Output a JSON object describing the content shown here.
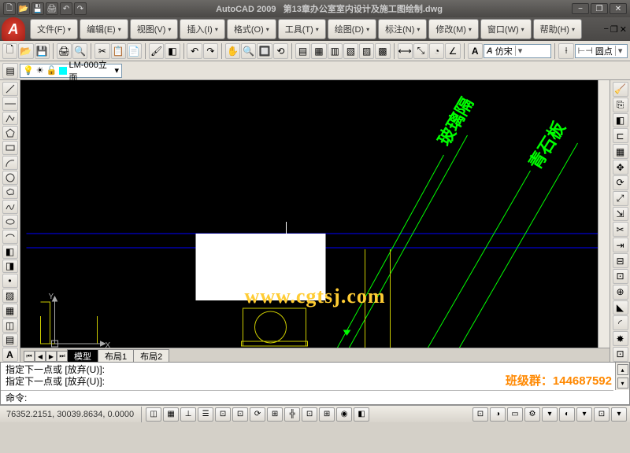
{
  "title": {
    "app": "AutoCAD 2009",
    "doc": "第13章办公室室内设计及施工图绘制.dwg"
  },
  "qat": {
    "save": "💾",
    "new": "🗋",
    "open": "📂",
    "undo": "↶",
    "redo": "↷",
    "plot": "🖨"
  },
  "win": {
    "min": "−",
    "max": "❐",
    "close": "✕"
  },
  "menu": {
    "file": "文件(F)",
    "edit": "编辑(E)",
    "view": "视图(V)",
    "insert": "插入(I)",
    "format": "格式(O)",
    "tools": "工具(T)",
    "draw": "绘图(D)",
    "dimension": "标注(N)",
    "modify": "修改(M)",
    "window": "窗口(W)",
    "help": "帮助(H)"
  },
  "layer": {
    "current": "LM-000立面"
  },
  "style": {
    "font": "仿宋",
    "dim": "圆点"
  },
  "tabs": {
    "model": "模型",
    "layout1": "布局1",
    "layout2": "布局2"
  },
  "cmd": {
    "line1": "指定下一点或 [放弃(U)]:",
    "line2": "指定下一点或 [放弃(U)]:",
    "prompt": "命令:"
  },
  "overlay": {
    "group": "班级群：144687592"
  },
  "status": {
    "coords": "76352.2151, 30039.8634, 0.0000"
  },
  "watermark": "www.cgtsj.com",
  "canvas": {
    "ann1": "玻璃隔",
    "ann2": "青石板",
    "ucs_x": "X",
    "ucs_y": "Y"
  },
  "statusbtns": [
    "◫",
    "▦",
    "⊥",
    "☰",
    "⊡",
    "⊡",
    "⟳",
    "⊞",
    "╬",
    "⊡",
    "⊞",
    "◉",
    "◧"
  ],
  "rightstatus": [
    "⊡",
    "◑",
    "▭",
    "⚙",
    "▾",
    "◐",
    "▾",
    "⊡",
    "▾"
  ]
}
